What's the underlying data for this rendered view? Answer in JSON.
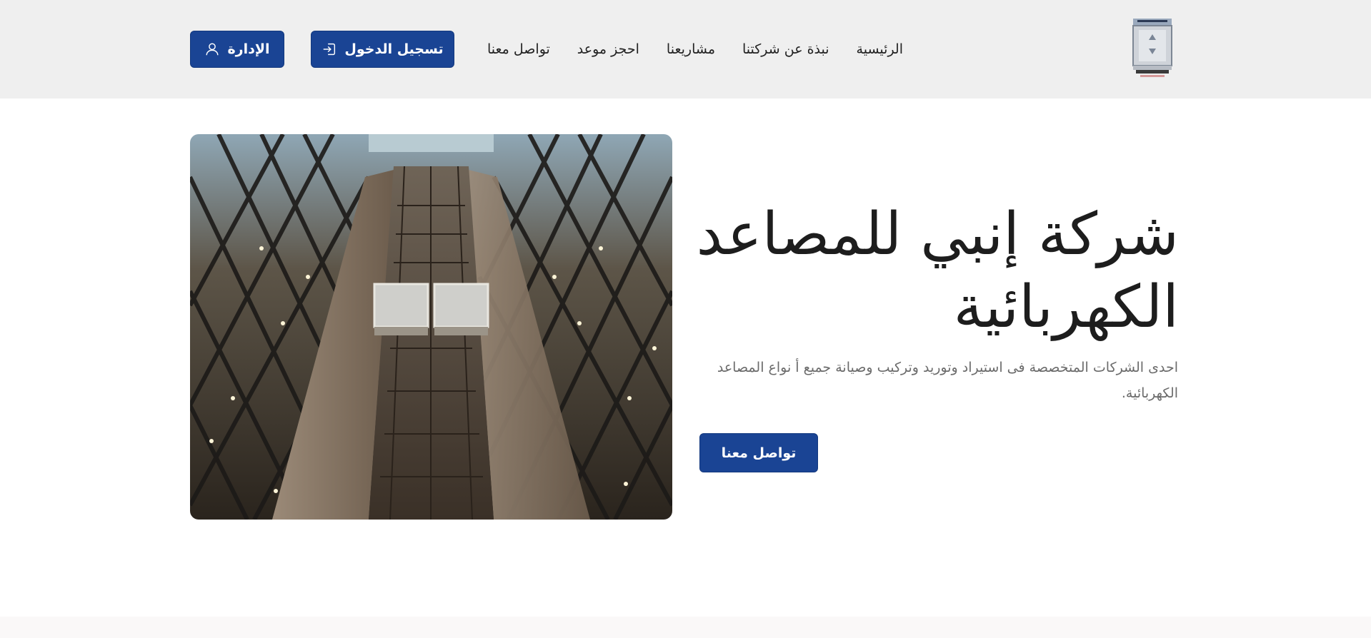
{
  "header": {
    "logo_icon": "elevator-logo-icon",
    "nav": [
      {
        "label": "الرئيسية"
      },
      {
        "label": "نبذة عن شركتنا"
      },
      {
        "label": "مشاريعنا"
      },
      {
        "label": "احجز موعد"
      },
      {
        "label": "تواصل معنا"
      }
    ],
    "login_button": {
      "label": "تسجيل الدخول",
      "icon": "login-icon"
    },
    "admin_button": {
      "label": "الإدارة",
      "icon": "user-icon"
    }
  },
  "hero": {
    "title": "شركة إنبي للمصاعد الكهربائية",
    "description": "احدى الشركات المتخصصة فى استيراد وتوريد وتركيب وصيانة جميع أ نواع المصاعد الكهربائية.",
    "cta_label": "تواصل معنا",
    "image": "glass-elevator-atrium-photo"
  },
  "colors": {
    "primary": "#1a4494",
    "header_bg": "#efefef",
    "text_dark": "#1d1d1d",
    "text_muted": "#6b6b6b"
  }
}
